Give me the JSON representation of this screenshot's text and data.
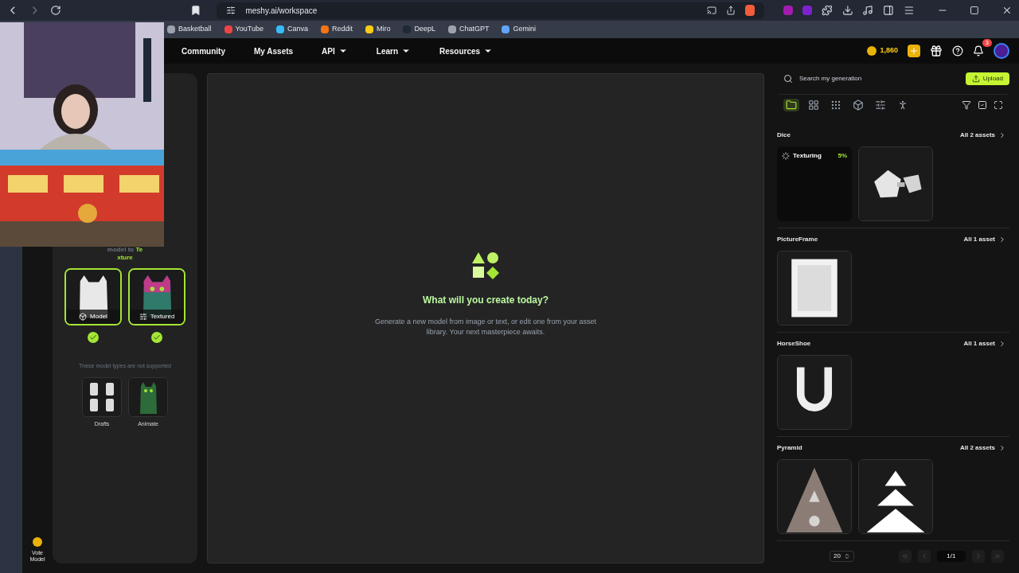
{
  "browser": {
    "url": "meshy.ai/workspace",
    "bookmarks": [
      {
        "label": "Basketball",
        "color": "#9ca3af"
      },
      {
        "label": "YouTube",
        "color": "#ef4444"
      },
      {
        "label": "Canva",
        "color": "#38bdf8"
      },
      {
        "label": "Reddit",
        "color": "#f97316"
      },
      {
        "label": "Miro",
        "color": "#facc15"
      },
      {
        "label": "DeepL",
        "color": "#1f2937"
      },
      {
        "label": "ChatGPT",
        "color": "#9ca3af"
      },
      {
        "label": "Gemini",
        "color": "#60a5fa"
      }
    ]
  },
  "nav": {
    "items": [
      {
        "label": "Community",
        "dropdown": false
      },
      {
        "label": "My Assets",
        "dropdown": false
      },
      {
        "label": "API",
        "dropdown": true
      },
      {
        "label": "Learn",
        "dropdown": true
      },
      {
        "label": "Resources",
        "dropdown": true
      }
    ],
    "credits": "1,860",
    "notifications": "3"
  },
  "left_panel": {
    "hint_lines": [
      {
        "plain": "model to",
        "accent": "Te"
      },
      {
        "accent": "xture"
      }
    ],
    "supported": [
      {
        "label": "Model",
        "checked": true,
        "kind": "model"
      },
      {
        "label": "Textured",
        "checked": true,
        "kind": "textured"
      }
    ],
    "unsupported_note": "These model types are not supported",
    "unsupported": [
      {
        "label": "Drafts",
        "kind": "drafts"
      },
      {
        "label": "Animate",
        "kind": "animate"
      }
    ],
    "vote": "Vote Model"
  },
  "center": {
    "title": "What will you create today?",
    "text": "Generate a new model from image or text, or edit one from your asset library. Your next masterpiece awaits."
  },
  "library": {
    "search_placeholder": "Search my generation",
    "upload": "Upload",
    "filters": [
      {
        "kind": "folder",
        "selected": true
      },
      {
        "kind": "grid",
        "selected": false
      },
      {
        "kind": "dots",
        "selected": false
      },
      {
        "kind": "cube",
        "selected": false
      },
      {
        "kind": "texture",
        "selected": false
      },
      {
        "kind": "run",
        "selected": false
      }
    ],
    "groups": [
      {
        "name": "Dice",
        "link": "All 2 assets",
        "items": [
          {
            "kind": "progress",
            "status": "Texturing",
            "percent": "5%"
          },
          {
            "kind": "dice"
          }
        ]
      },
      {
        "name": "PictureFrame",
        "link": "All 1 asset",
        "items": [
          {
            "kind": "frame"
          }
        ]
      },
      {
        "name": "HorseShoe",
        "link": "All 1 asset",
        "items": [
          {
            "kind": "horseshoe"
          }
        ]
      },
      {
        "name": "Pyramid",
        "link": "All 2 assets",
        "items": [
          {
            "kind": "pyramid_textured"
          },
          {
            "kind": "pyramid"
          }
        ]
      }
    ],
    "pagination": {
      "page_size": "20",
      "page": "1/1"
    }
  }
}
